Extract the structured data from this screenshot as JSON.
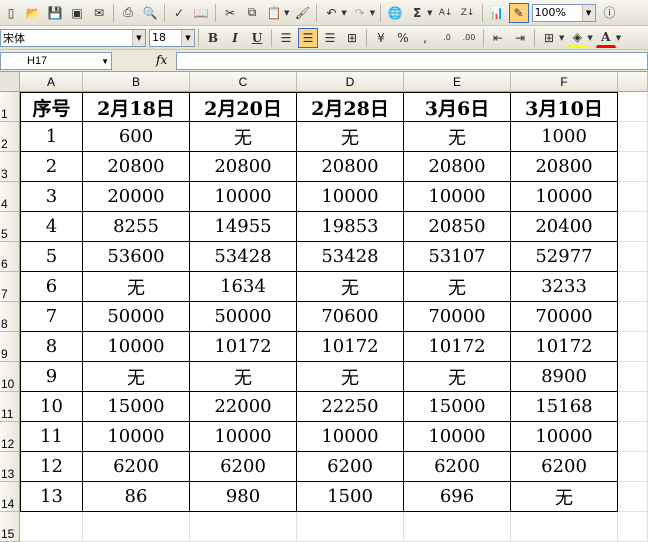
{
  "toolbar": {
    "zoom": "100%",
    "font_name": "宋体",
    "font_size": "18"
  },
  "formula_bar": {
    "name_box": "H17",
    "fx": "fx",
    "formula": ""
  },
  "sheet": {
    "columns": [
      "A",
      "B",
      "C",
      "D",
      "E",
      "F"
    ],
    "rows": [
      "1",
      "2",
      "3",
      "4",
      "5",
      "6",
      "7",
      "8",
      "9",
      "10",
      "11",
      "12",
      "13",
      "14",
      "15"
    ],
    "header": [
      "序号",
      "2月18日",
      "2月20日",
      "2月28日",
      "3月6日",
      "3月10日"
    ],
    "data": [
      [
        "1",
        "600",
        "无",
        "无",
        "无",
        "1000"
      ],
      [
        "2",
        "20800",
        "20800",
        "20800",
        "20800",
        "20800"
      ],
      [
        "3",
        "20000",
        "10000",
        "10000",
        "10000",
        "10000"
      ],
      [
        "4",
        "8255",
        "14955",
        "19853",
        "20850",
        "20400"
      ],
      [
        "5",
        "53600",
        "53428",
        "53428",
        "53107",
        "52977"
      ],
      [
        "6",
        "无",
        "1634",
        "无",
        "无",
        "3233"
      ],
      [
        "7",
        "50000",
        "50000",
        "70600",
        "70000",
        "70000"
      ],
      [
        "8",
        "10000",
        "10172",
        "10172",
        "10172",
        "10172"
      ],
      [
        "9",
        "无",
        "无",
        "无",
        "无",
        "8900"
      ],
      [
        "10",
        "15000",
        "22000",
        "22250",
        "15000",
        "15168"
      ],
      [
        "11",
        "10000",
        "10000",
        "10000",
        "10000",
        "10000"
      ],
      [
        "12",
        "6200",
        "6200",
        "6200",
        "6200",
        "6200"
      ],
      [
        "13",
        "86",
        "980",
        "1500",
        "696",
        "无"
      ]
    ]
  }
}
